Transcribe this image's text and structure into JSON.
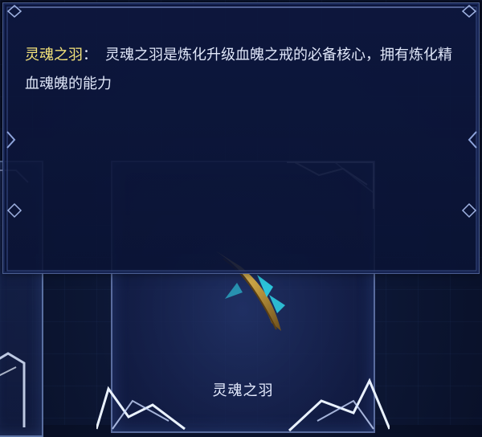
{
  "tooltip": {
    "title": "灵魂之羽",
    "colon": "：",
    "description": "灵魂之羽是炼化升级血魄之戒的必备核心，拥有炼化精血魂魄的能力"
  },
  "item_card": {
    "name": "灵魂之羽",
    "icon": "golden-feather-icon"
  },
  "colors": {
    "title_highlight": "#f5e47a",
    "body_text": "#dfe6f8",
    "panel_bg": "#0d173e",
    "frame_line": "#8ea4dc",
    "feather_gold": "#c9a243",
    "feather_cyan": "#2fd4e6"
  }
}
